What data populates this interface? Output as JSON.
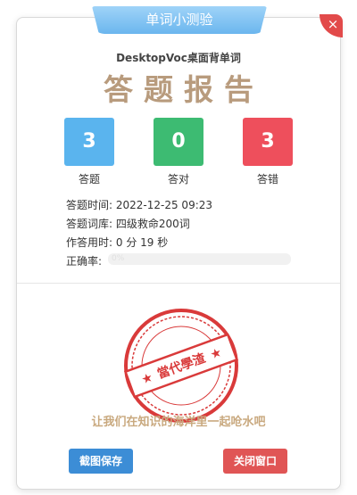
{
  "window": {
    "title": "单词小测验",
    "close_symbol": "×"
  },
  "header": {
    "app_name": "DesktopVoc桌面背单词",
    "report_title": "答题报告"
  },
  "stats": [
    {
      "value": "3",
      "label": "答题",
      "color": "#5ab4ee"
    },
    {
      "value": "0",
      "label": "答对",
      "color": "#3dbb72"
    },
    {
      "value": "3",
      "label": "答错",
      "color": "#ee4f5c"
    }
  ],
  "info": {
    "time_label": "答题时间:",
    "time_value": "2022-12-25 09:23",
    "library_label": "答题词库:",
    "library_value": "四级救命200词",
    "duration_label": "作答用时:",
    "duration_value": "0 分 19 秒",
    "accuracy_label": "正确率:",
    "accuracy_value": "0%",
    "accuracy_fraction": 0
  },
  "stamp": {
    "text": "當代學渣",
    "color": "#d93a3a"
  },
  "slogan": "让我们在知识的海洋里一起呛水吧",
  "buttons": {
    "save": "截图保存",
    "close": "关闭窗口"
  }
}
